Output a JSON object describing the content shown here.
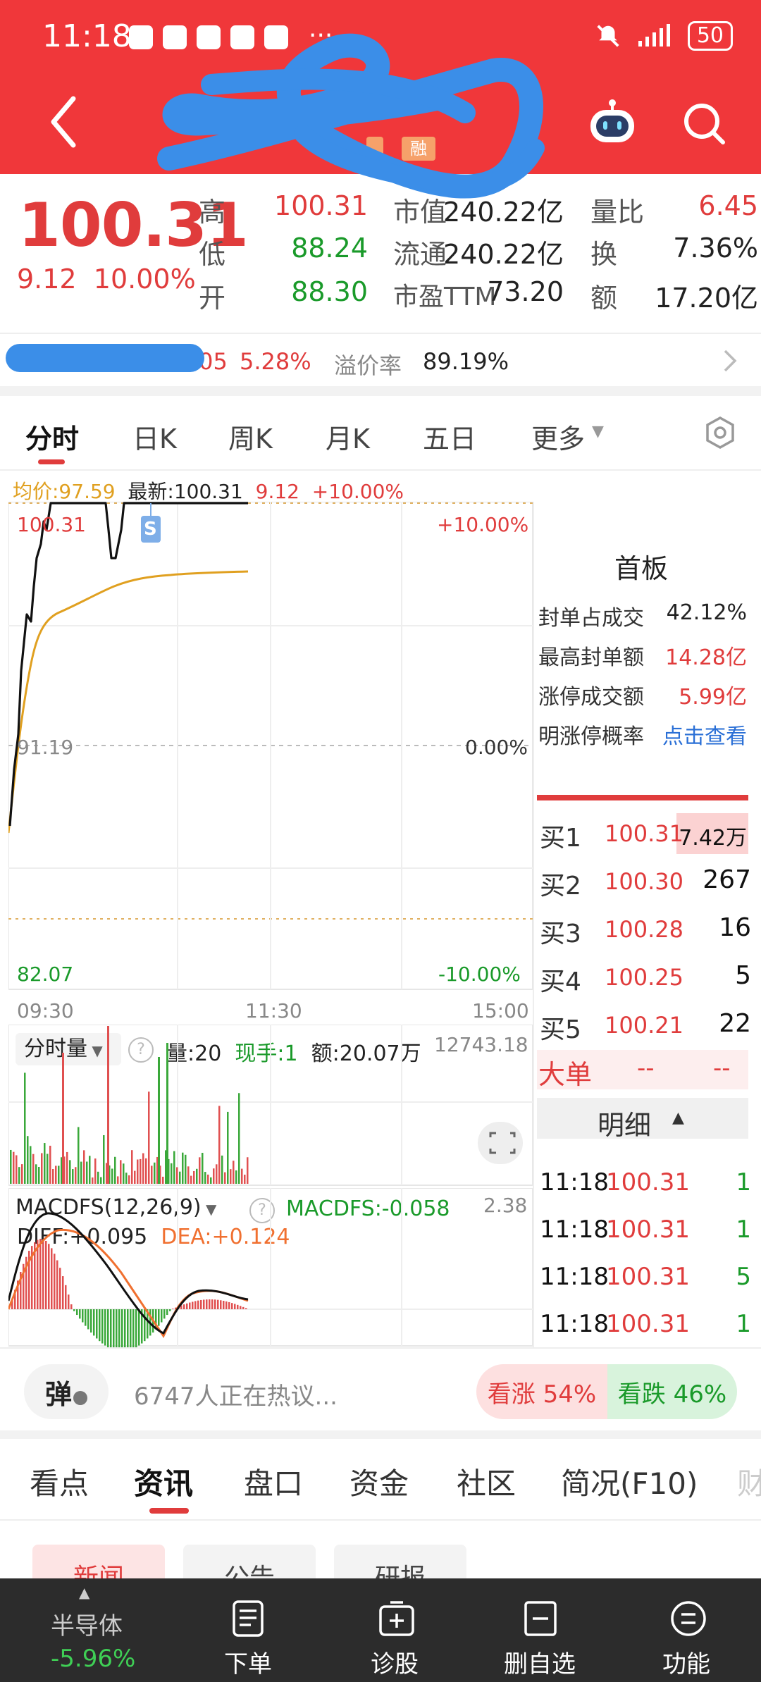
{
  "status_bar": {
    "time": "11:18",
    "dots": "···",
    "battery": "50"
  },
  "header": {
    "tags": [
      "融"
    ]
  },
  "quote": {
    "price": "100.31",
    "change": "9.12",
    "change_pct": "10.00%",
    "cells": [
      {
        "label": "高",
        "value": "100.31",
        "color": "red"
      },
      {
        "label": "市值",
        "value": "240.22亿",
        "color": "dark"
      },
      {
        "label": "量比",
        "value": "6.45",
        "color": "red"
      },
      {
        "label": "低",
        "value": "88.24",
        "color": "green"
      },
      {
        "label": "流通",
        "value": "240.22亿",
        "color": "dark"
      },
      {
        "label": "换",
        "value": "7.36%",
        "color": "dark"
      },
      {
        "label": "开",
        "value": "88.30",
        "color": "green"
      },
      {
        "label": "市盈TTM",
        "value": "73.20",
        "color": "dark"
      },
      {
        "label": "额",
        "value": "17.20亿",
        "color": "dark"
      }
    ],
    "premium_left_num": ".05",
    "premium_left_pct": "5.28%",
    "premium_label": "溢价率",
    "premium_value": "89.19%"
  },
  "chart_tabs": {
    "items": [
      "分时",
      "日K",
      "周K",
      "月K",
      "五日",
      "更多"
    ],
    "active": 0
  },
  "intraday": {
    "avg_label": "均价:97.59",
    "latest_label": "最新:100.31",
    "latest_chg": "9.12",
    "latest_pct": "+10.00%",
    "top_price": "100.31",
    "top_pct": "+10.00%",
    "mid_price": "91.19",
    "mid_pct": "0.00%",
    "bottom_price": "82.07",
    "bottom_pct": "-10.00%",
    "times": [
      "09:30",
      "11:30",
      "15:00"
    ],
    "marker": "S"
  },
  "volume_panel": {
    "selector": "分时量",
    "vol": "量:20",
    "hand": "现手:1",
    "amount": "额:20.07万",
    "max": "12743.18"
  },
  "macd_panel": {
    "selector": "MACDFS(12,26,9)",
    "macd": "MACDFS:-0.058",
    "diff": "DIFF:+0.095",
    "dea": "DEA:+0.124",
    "max": "2.38"
  },
  "right_panel": {
    "board": "首板",
    "stats": [
      {
        "label": "封单占成交",
        "value": "42.12%",
        "color": "dark"
      },
      {
        "label": "最高封单额",
        "value": "14.28亿",
        "color": "red"
      },
      {
        "label": "涨停成交额",
        "value": "5.99亿",
        "color": "red"
      },
      {
        "label": "明涨停概率",
        "value": "点击查看",
        "color": "blue"
      }
    ],
    "bids": [
      {
        "label": "买1",
        "price": "100.31",
        "vol": "7.42万"
      },
      {
        "label": "买2",
        "price": "100.30",
        "vol": "267"
      },
      {
        "label": "买3",
        "price": "100.28",
        "vol": "16"
      },
      {
        "label": "买4",
        "price": "100.25",
        "vol": "5"
      },
      {
        "label": "买5",
        "price": "100.21",
        "vol": "22"
      }
    ],
    "big_order": "大单",
    "big_a": "--",
    "big_b": "--",
    "detail": "明细",
    "ticks": [
      {
        "time": "11:18",
        "price": "100.31",
        "vol": "1"
      },
      {
        "time": "11:18",
        "price": "100.31",
        "vol": "1"
      },
      {
        "time": "11:18",
        "price": "100.31",
        "vol": "5"
      },
      {
        "time": "11:18",
        "price": "100.31",
        "vol": "1"
      }
    ]
  },
  "hot_bar": {
    "danmu": "弹",
    "text": "6747人正在热议...",
    "bull": "看涨 54%",
    "bear": "看跌 46%"
  },
  "news_tabs": {
    "items": [
      "看点",
      "资讯",
      "盘口",
      "资金",
      "社区",
      "简况(F10)",
      "财"
    ],
    "active": 1
  },
  "news_subtabs": [
    "新闻",
    "公告",
    "研报"
  ],
  "bottom_nav": {
    "sector": "半导体",
    "sector_chg": "-5.96%",
    "items": [
      "下单",
      "诊股",
      "删自选",
      "功能"
    ]
  },
  "colors": {
    "red": "#e03c3c",
    "green": "#1a9a2a",
    "header": "#f0373a",
    "avg_line": "#e0a020"
  }
}
